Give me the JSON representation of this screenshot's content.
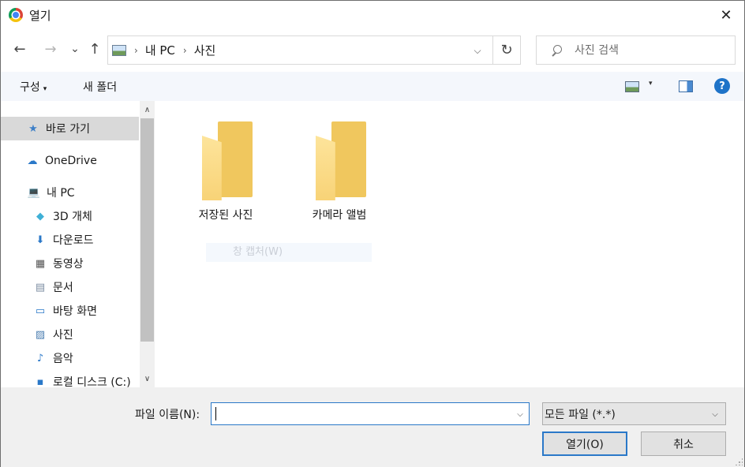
{
  "window": {
    "title": "열기",
    "close_label": "✕"
  },
  "nav": {
    "back_icon": "←",
    "forward_icon": "→",
    "recent_icon": "⌄",
    "up_icon": "↑",
    "breadcrumb": [
      "내 PC",
      "사진"
    ],
    "separator": "›",
    "refresh_icon": "↻",
    "dropdown_icon": "⌵",
    "search_placeholder": "사진 검색"
  },
  "toolbar": {
    "organize_label": "구성",
    "new_folder_label": "새 폴더",
    "help_label": "?",
    "caret": "▾"
  },
  "sidebar": {
    "items": [
      {
        "label": "바로 가기",
        "icon": "star-icon",
        "glyph": "★",
        "selected": true
      },
      {
        "label": "OneDrive",
        "icon": "cloud-icon",
        "glyph": "☁",
        "selected": false
      },
      {
        "label": "내 PC",
        "icon": "computer-icon",
        "glyph": "💻",
        "selected": false
      },
      {
        "label": "3D 개체",
        "icon": "cube-icon",
        "glyph": "◆",
        "selected": false
      },
      {
        "label": "다운로드",
        "icon": "download-icon",
        "glyph": "⬇",
        "selected": false
      },
      {
        "label": "동영상",
        "icon": "film-icon",
        "glyph": "▦",
        "selected": false
      },
      {
        "label": "문서",
        "icon": "document-icon",
        "glyph": "▤",
        "selected": false
      },
      {
        "label": "바탕 화면",
        "icon": "desktop-icon",
        "glyph": "▭",
        "selected": false
      },
      {
        "label": "사진",
        "icon": "picture-icon",
        "glyph": "▨",
        "selected": false
      },
      {
        "label": "음악",
        "icon": "music-icon",
        "glyph": "♪",
        "selected": false
      },
      {
        "label": "로컬 디스크 (C:)",
        "icon": "drive-icon",
        "glyph": "▪",
        "selected": false
      }
    ],
    "scroll_up": "∧",
    "scroll_down": "∨"
  },
  "content": {
    "folders": [
      {
        "label": "저장된 사진"
      },
      {
        "label": "카메라 앨범"
      }
    ],
    "ghost_text": "창 캡처(W)"
  },
  "footer": {
    "filename_label": "파일 이름(N):",
    "filename_value": "",
    "filter_value": "모든 파일 (*.*)",
    "open_label": "열기(O)",
    "cancel_label": "취소",
    "dropdown_icon": "⌵"
  },
  "colors": {
    "accent": "#2a78c8",
    "toolbar_bg": "#f4f7fc",
    "footer_bg": "#f0f0f0",
    "selected_bg": "#d9d9d9",
    "folder": "#f8d377"
  }
}
